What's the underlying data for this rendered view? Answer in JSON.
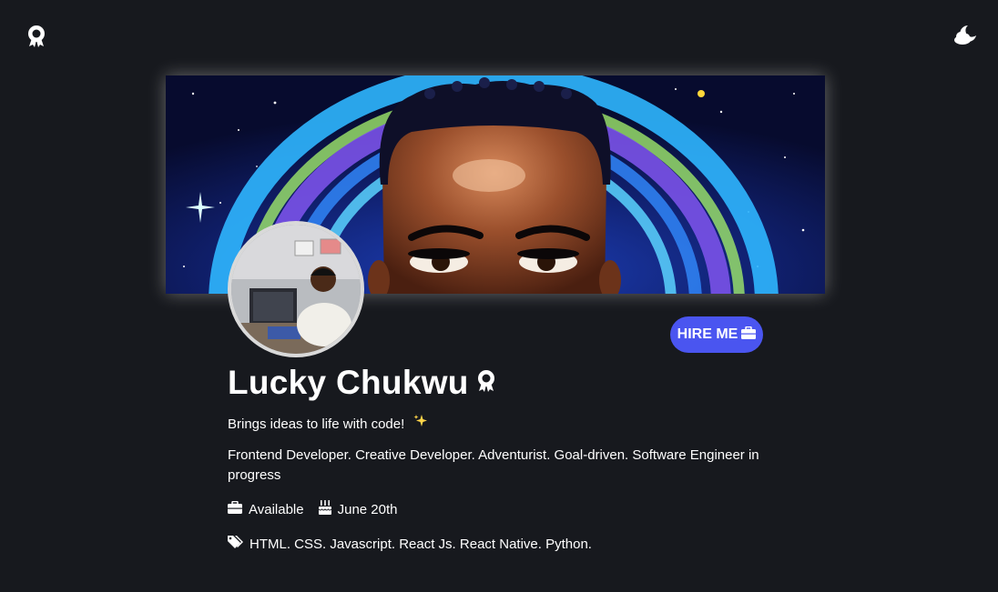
{
  "header": {
    "logo_icon": "award-ribbon-icon",
    "theme_toggle_icon": "cloud-moon-icon"
  },
  "profile": {
    "name": "Lucky Chukwu",
    "name_badge_icon": "award-ribbon-icon",
    "tagline": "Brings ideas to life with code!",
    "tagline_icon": "sparkles-icon",
    "bio": "Frontend Developer. Creative Developer. Adventurist. Goal-driven. Software Engineer in progress",
    "availability": "Available",
    "availability_icon": "briefcase-icon",
    "birthday": "June 20th",
    "birthday_icon": "cake-icon",
    "skills": "HTML. CSS. Javascript. React Js. React Native. Python.",
    "skills_icon": "tags-icon"
  },
  "actions": {
    "hire_label": "HIRE ME",
    "hire_icon": "briefcase-icon"
  },
  "colors": {
    "background": "#17191e",
    "accent": "#4a55f0"
  }
}
